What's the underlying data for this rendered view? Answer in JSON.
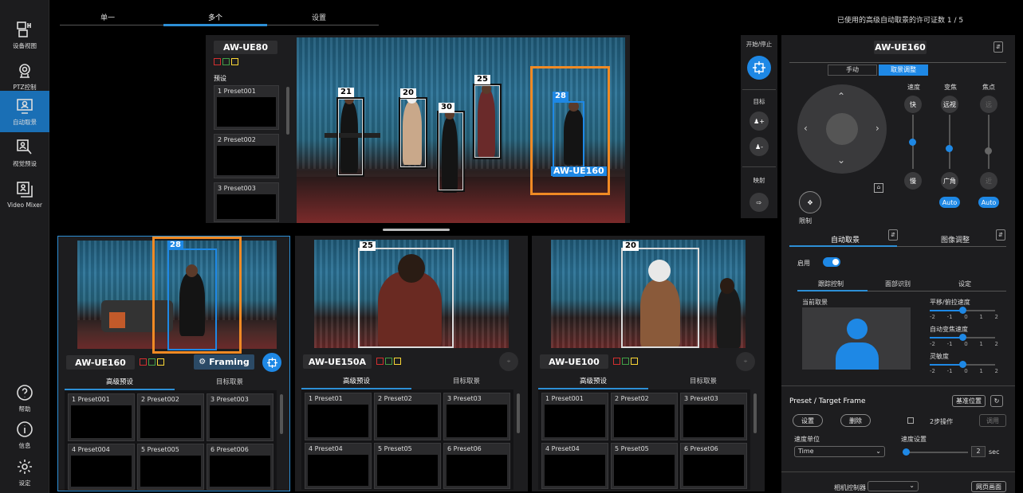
{
  "sidebar": {
    "items": [
      {
        "label": "设备视图",
        "icon": "device-view-icon"
      },
      {
        "label": "PTZ控制",
        "icon": "ptz-camera-icon"
      },
      {
        "label": "自动取景",
        "icon": "auto-framing-icon"
      },
      {
        "label": "视觉预设",
        "icon": "visual-preset-icon"
      },
      {
        "label": "Video Mixer",
        "icon": "video-mixer-icon"
      }
    ],
    "bottom": [
      {
        "label": "帮助",
        "icon": "help-icon"
      },
      {
        "label": "信息",
        "icon": "info-icon"
      },
      {
        "label": "设定",
        "icon": "settings-gear-icon"
      }
    ]
  },
  "top_tabs": [
    "单一",
    "多个",
    "设置"
  ],
  "license_text": "已使用的高级自动取景的许可证数 1 / 5",
  "main_view": {
    "camera": "AW-UE80",
    "preset_header": "预设",
    "presets": [
      "1 Preset001",
      "2 Preset002",
      "3 Preset003"
    ],
    "tags": [
      "21",
      "20",
      "30",
      "25",
      "28"
    ],
    "tracked_label": "AW-UE160"
  },
  "side_controls": {
    "start_stop": "开始/停止",
    "target": "目标",
    "mapping": "映射"
  },
  "cams": [
    {
      "name": "AW-UE160",
      "tag": "28",
      "framing": "Framing",
      "tabs": [
        "高级预设",
        "目标取景"
      ],
      "presets": [
        "1 Preset001",
        "2 Preset002",
        "3 Preset003",
        "4 Preset004",
        "5 Preset005",
        "6 Preset006"
      ]
    },
    {
      "name": "AW-UE150A",
      "tag": "25",
      "tabs": [
        "高级预设",
        "目标取景"
      ],
      "presets": [
        "1 Preset01",
        "2 Preset02",
        "3 Preset03",
        "4 Preset04",
        "5 Preset05",
        "6 Preset06"
      ]
    },
    {
      "name": "AW-UE100",
      "tag": "20",
      "tabs": [
        "高级预设",
        "目标取景"
      ],
      "presets": [
        "1 Preset001",
        "2 Preset02",
        "3 Preset03",
        "4 Preset04",
        "5 Preset05",
        "6 Preset06"
      ]
    }
  ],
  "right": {
    "camera": "AW-UE160",
    "mode_tabs": [
      "手动",
      "取景调整"
    ],
    "speed": "速度",
    "zoom": "变焦",
    "focus": "焦点",
    "fast": "快",
    "slow": "慢",
    "tele": "远视",
    "wide": "广角",
    "far": "远",
    "near": "近",
    "auto": "Auto",
    "limit": "限制",
    "section_tabs": [
      "自动取景",
      "图像调整"
    ],
    "enable": "启用",
    "sub_tabs": [
      "跟踪控制",
      "面部识别",
      "设定"
    ],
    "current_framing": "当前取景",
    "pan_tilt_speed": "平移/俯拉速度",
    "auto_zoom_speed": "自动变焦速度",
    "sensitivity": "灵敏度",
    "scale": [
      "-2",
      "-1",
      "0",
      "1",
      "2"
    ],
    "preset_title": "Preset / Target Frame",
    "base_position": "基准位置",
    "set": "设置",
    "delete": "删除",
    "two_step": "2步操作",
    "call": "调用",
    "speed_unit": "速度单位",
    "speed_unit_value": "Time",
    "speed_setting": "速度设置",
    "speed_value": "2",
    "sec": "sec",
    "camera_controller": "相机控制器",
    "web_screen": "网页画面"
  }
}
